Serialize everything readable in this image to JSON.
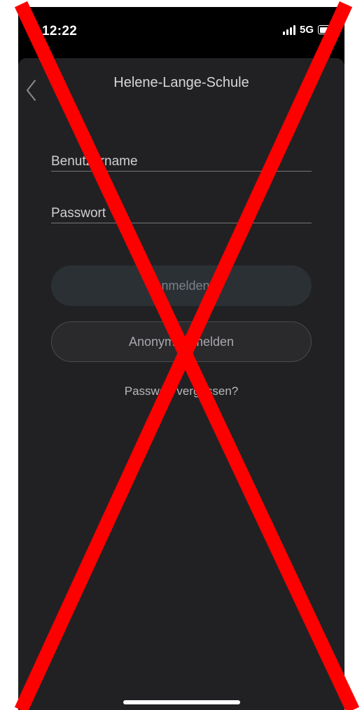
{
  "status_bar": {
    "time": "12:22",
    "network": "5G",
    "signal_icon": "signal-bars-icon",
    "battery_icon": "battery-icon"
  },
  "header": {
    "title": "Helene-Lange-Schule",
    "back_icon": "chevron-left-icon"
  },
  "form": {
    "username_placeholder": "Benutzername",
    "password_placeholder": "Passwort",
    "login_button": "Anmelden",
    "anonymous_button": "Anonym anmelden",
    "forgot_link": "Passwort vergessen?"
  },
  "overlay": {
    "type": "red-x-cross-out",
    "color": "#ff0000"
  },
  "colors": {
    "background": "#000000",
    "sheet": "#212123",
    "login_button_bg": "#2b3034",
    "anon_button_bg": "#2a2a2d"
  }
}
